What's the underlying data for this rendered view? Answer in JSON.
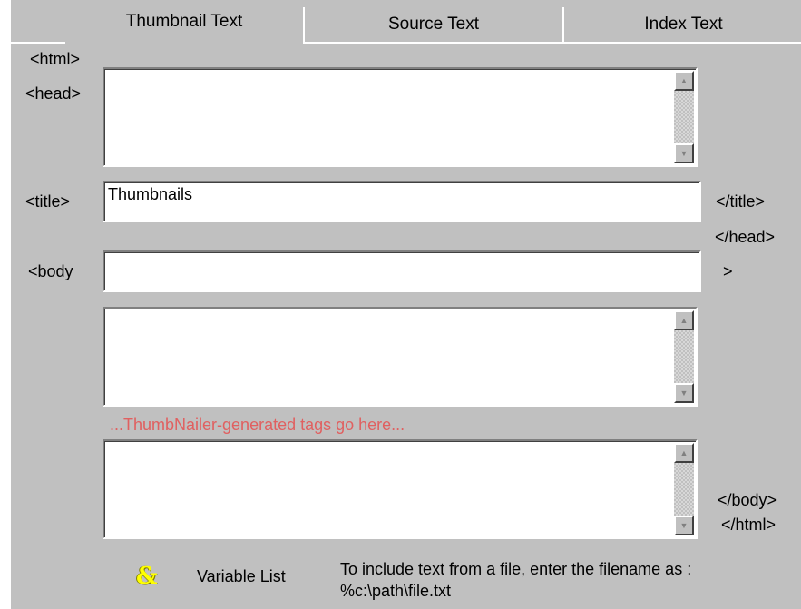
{
  "tabs": [
    {
      "label": "Thumbnail Text",
      "active": true
    },
    {
      "label": "Source Text",
      "active": false
    },
    {
      "label": "Index Text",
      "active": false
    }
  ],
  "labels": {
    "html_open": "<html>",
    "head_open": "<head>",
    "title_open": "<title>",
    "title_close": "</title>",
    "head_close": "</head>",
    "body_open": "<body",
    "body_gt": ">",
    "body_close": "</body>",
    "html_close": "</html>"
  },
  "fields": {
    "head_text": "",
    "title_value": "Thumbnails",
    "body_attributes": "",
    "body_top_text": "",
    "body_bottom_text": ""
  },
  "hint_text": "...ThumbNailer-generated tags go here...",
  "footer": {
    "variables_icon": "&",
    "variable_list_label": "Variable List",
    "note_line1": "To include text from a file, enter the filename as  :",
    "note_line2": "%c:\\path\\file.txt"
  },
  "colors": {
    "panel": "#c0c0c0",
    "hint": "#e06060",
    "variables_icon": "#ffff00"
  },
  "icons": {
    "scroll_up": "scroll-up-arrow-icon",
    "scroll_down": "scroll-down-arrow-icon",
    "variables": "ampersand-icon"
  }
}
